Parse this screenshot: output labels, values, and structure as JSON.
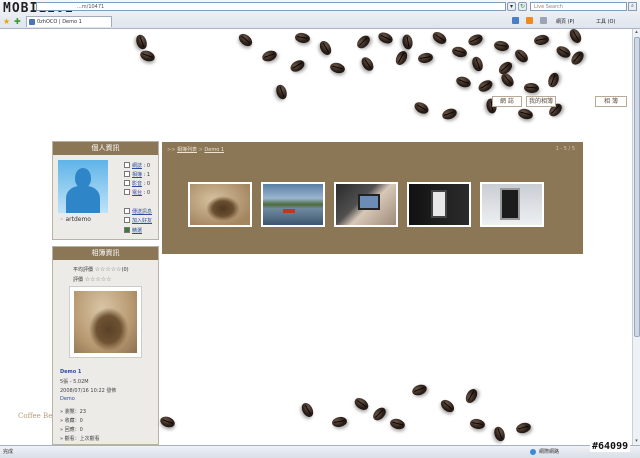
{
  "browser": {
    "watermark_logo": "MOBILE01",
    "address": "...m/10471",
    "search_placeholder": "Live Search",
    "tab_title": "0zhOCO | Demo 1",
    "menu_page": "網頁 (P)",
    "menu_tools": "工具 (O)"
  },
  "top_tabs": [
    "網 誌",
    "我的相簿",
    "相 簿"
  ],
  "profile": {
    "header": "個人資訊",
    "username": "artdemo",
    "links": [
      {
        "label": "網誌",
        "count": "0"
      },
      {
        "label": "相簿",
        "count": "1"
      },
      {
        "label": "影音",
        "count": "0"
      },
      {
        "label": "電台",
        "count": "0"
      },
      {
        "label": "傳送訊息",
        "count": ""
      },
      {
        "label": "加入好友",
        "count": ""
      },
      {
        "label": "精選",
        "count": ""
      }
    ]
  },
  "album_info": {
    "header": "相簿資訊",
    "avg_rating_label": "平均評價",
    "avg_rating_stars": "☆☆☆☆☆",
    "avg_rating_count": "(0)",
    "rating_label": "評價",
    "rating_stars": "☆☆☆☆☆",
    "photo_title": "Demo 1",
    "photo_size": "5張 - 5.02M",
    "photo_date": "2008/07/16 10:22 發佈",
    "photo_desc": "Demo",
    "stat_views_label": "瀏覽：",
    "stat_views": "23",
    "stat_fav_label": "收藏：",
    "stat_fav": "0",
    "stat_comments_label": "回應：",
    "stat_comments": "0",
    "stat_last_label": "觀看：",
    "stat_last": "上次觀看"
  },
  "gallery": {
    "breadcrumb_prefix": ">>",
    "breadcrumb_home": "相簿列表",
    "breadcrumb_sep": ">",
    "breadcrumb_album": "Demo 1",
    "pager": "1 - 5 / 5",
    "thumbnails": [
      {
        "name": "squirrel"
      },
      {
        "name": "lake-boat"
      },
      {
        "name": "hand-device"
      },
      {
        "name": "dark-device"
      },
      {
        "name": "phone-white"
      }
    ]
  },
  "footer_text": "Coffee Be",
  "status": {
    "left": "完成",
    "zone": "網際網路"
  },
  "corner_watermark": "#64099"
}
